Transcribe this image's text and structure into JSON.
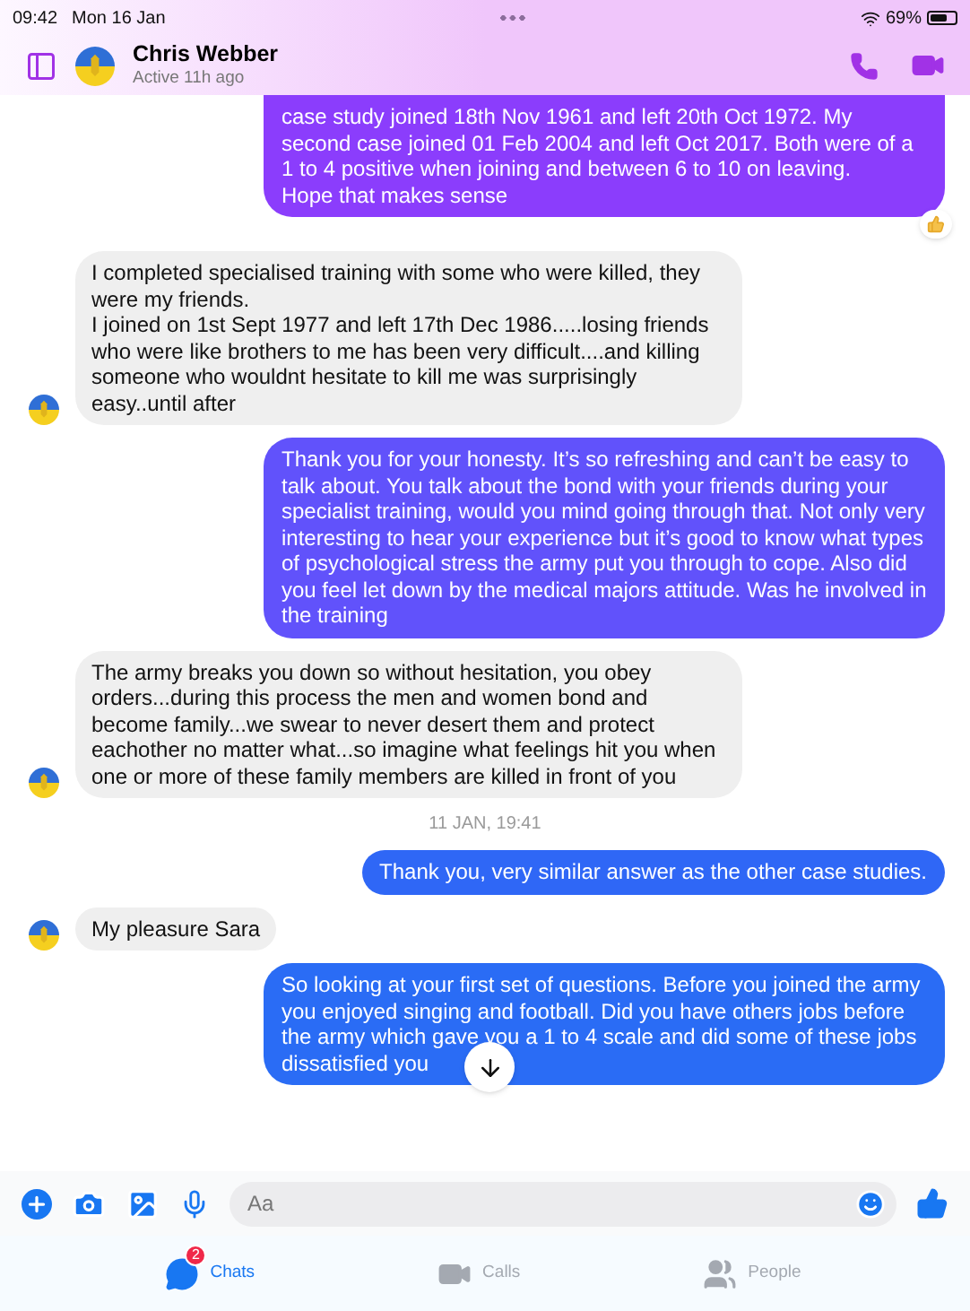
{
  "status_bar": {
    "time": "09:42",
    "date": "Mon 16 Jan",
    "battery": "69%"
  },
  "header": {
    "name": "Chris Webber",
    "status": "Active 11h ago"
  },
  "messages": [
    {
      "kind": "sent",
      "color": "#8b3dfc",
      "text": "case study joined 18th Nov 1961 and left 20th Oct 1972. My second case joined 01 Feb 2004 and left Oct 2017.  Both were of a 1 to 4 positive when joining and between 6 to 10 on leaving.\nHope that makes sense",
      "reacted": true,
      "cut_top": true
    },
    {
      "kind": "received",
      "text": "I completed specialised training with some who were killed, they were my friends.\nI joined on 1st Sept 1977 and left 17th Dec 1986.....losing friends who were like brothers to me has been very difficult....and killing someone who wouldnt hesitate to kill me was surprisingly easy..until after",
      "show_avatar": true
    },
    {
      "kind": "sent",
      "color": "#6152fb",
      "text": "Thank you for your honesty. It’s so refreshing and can’t be easy to talk about. You talk about the bond with your friends during your specialist training, would you mind going through that. Not only very interesting to hear your experience but it’s good to know what types of psychological stress the army put you through to cope. Also did you feel let down by the medical majors attitude. Was he involved in the training",
      "reacted": false
    },
    {
      "kind": "received",
      "text": "The army breaks you down so without hesitation, you obey orders...during this process the men and women bond and become family...we swear to never desert them and protect eachother no matter what...so imagine what feelings hit you when one or more of these family members are killed in front of you",
      "show_avatar": true
    },
    {
      "kind": "timestamp",
      "text": "11 JAN, 19:41"
    },
    {
      "kind": "sent",
      "color": "#2f67f6",
      "text": "Thank you, very similar answer as the other case studies.",
      "reacted": false
    },
    {
      "kind": "received",
      "text": "My pleasure Sara",
      "show_avatar": true
    },
    {
      "kind": "sent",
      "color": "#2a6cf5",
      "text": "So looking at your first set of questions. Before you joined the army you enjoyed singing and football. Did you have others jobs before the army which gave you a 1 to 4 scale and did some of these jobs dissatisfied you",
      "reacted": false,
      "scroll_button": true
    }
  ],
  "composer": {
    "placeholder": "Aa"
  },
  "tabs": [
    {
      "label": "Chats",
      "selected": true,
      "badge": "2",
      "kind": "chats"
    },
    {
      "label": "Calls",
      "selected": false,
      "kind": "calls"
    },
    {
      "label": "People",
      "selected": false,
      "kind": "people"
    }
  ]
}
